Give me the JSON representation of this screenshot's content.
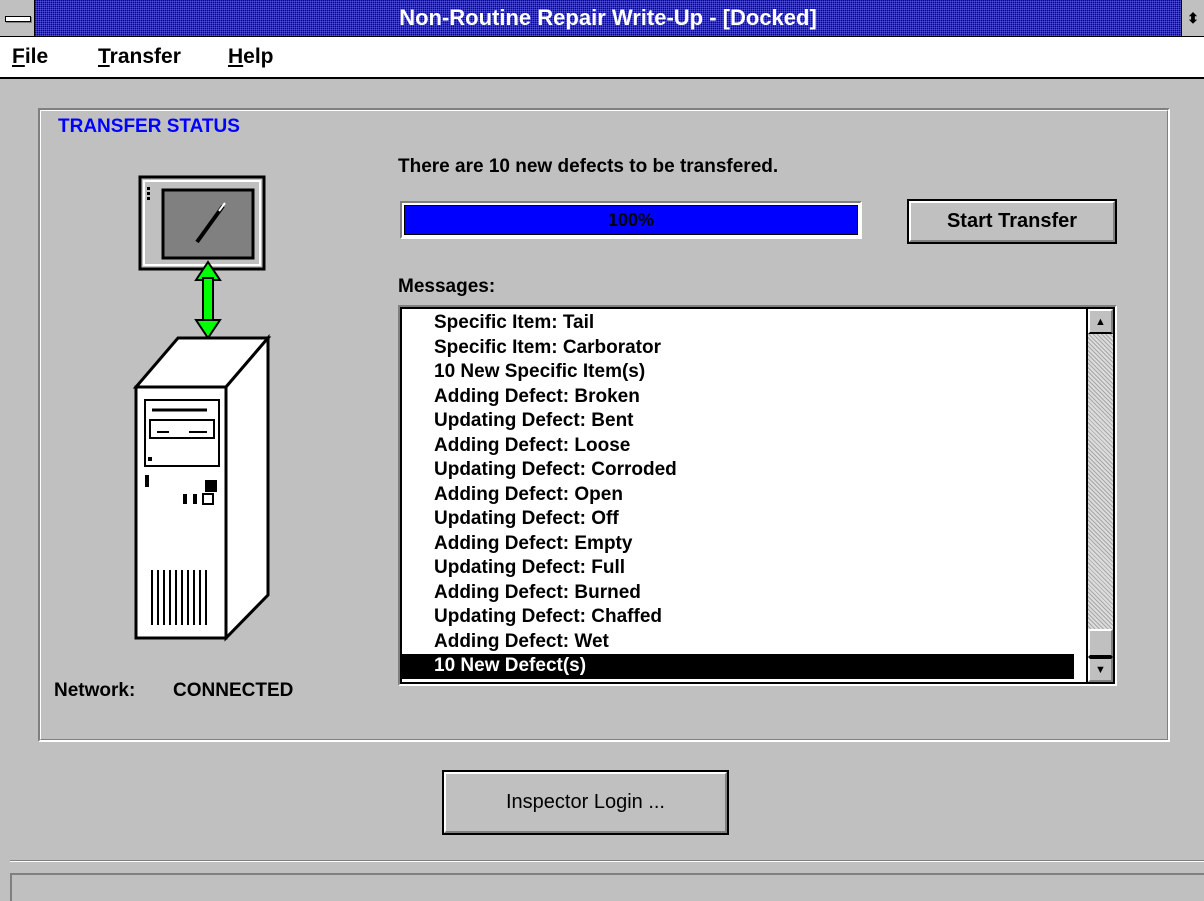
{
  "window": {
    "title": "Non-Routine Repair Write-Up - [Docked]",
    "restore_glyph": "⬍"
  },
  "menu": {
    "items": [
      {
        "label": "File",
        "mnemonic": "F",
        "rest": "ile"
      },
      {
        "label": "Transfer",
        "mnemonic": "T",
        "rest": "ransfer"
      },
      {
        "label": "Help",
        "mnemonic": "H",
        "rest": "elp"
      }
    ]
  },
  "transfer_status": {
    "group_title": "TRANSFER STATUS",
    "status_message": "There are 10 new defects to be transfered.",
    "progress": {
      "value": 100,
      "label": "100%",
      "color": "#0000ff"
    },
    "start_button": "Start Transfer",
    "messages_label": "Messages:",
    "network_label": "Network:",
    "network_status": "CONNECTED"
  },
  "messages": {
    "items": [
      "Specific Item: Tail",
      "Specific Item: Carborator",
      "10 New Specific Item(s)",
      "Adding Defect: Broken",
      "Updating Defect: Bent",
      "Adding Defect: Loose",
      "Updating Defect: Corroded",
      "Adding Defect: Open",
      "Updating Defect: Off",
      "Adding Defect: Empty",
      "Updating Defect: Full",
      "Adding Defect: Burned",
      "Updating Defect: Chaffed",
      "Adding Defect: Wet",
      "10 New Defect(s)"
    ],
    "selected_index": 14
  },
  "footer": {
    "login_button": "Inspector Login ..."
  },
  "icons": {
    "handheld": "handheld-terminal-icon",
    "link": "double-arrow-icon",
    "server": "server-tower-icon"
  },
  "colors": {
    "title_bar": "#0000a8",
    "group_title": "#0000ff",
    "link_arrow": "#00ff00",
    "face": "#c0c0c0"
  }
}
